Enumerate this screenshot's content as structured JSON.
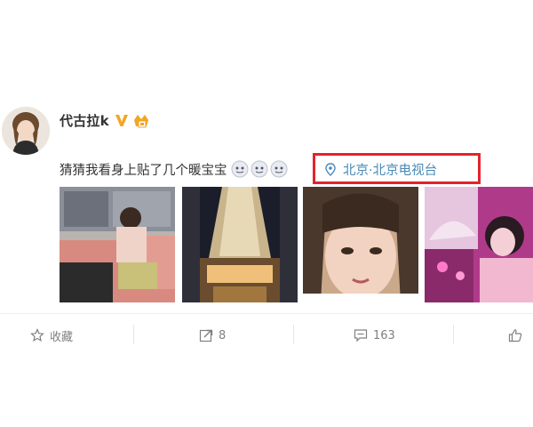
{
  "user": {
    "name": "代古拉k"
  },
  "post": {
    "text": "猜猜我看身上贴了几个暖宝宝",
    "location": "北京·北京电视台",
    "emoji_count": 3
  },
  "actions": {
    "favorite_label": "收藏",
    "repost_count": "8",
    "comment_count": "163"
  },
  "colors": {
    "highlight_box": "#e2242d",
    "location_link": "#4a8ab8",
    "verified_badge": "#f2a623"
  }
}
